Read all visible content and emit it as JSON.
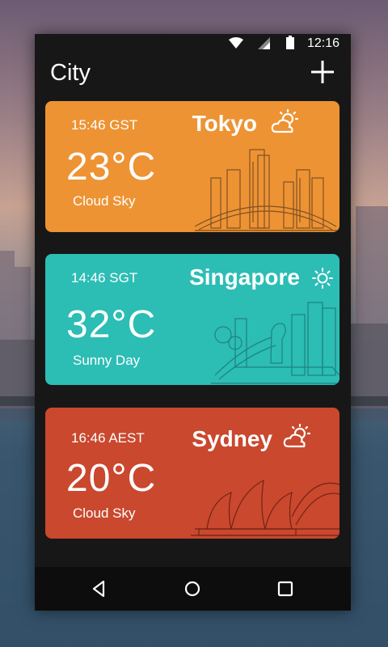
{
  "status_bar": {
    "time": "12:16",
    "icons": [
      "wifi-icon",
      "signal-icon",
      "battery-icon"
    ]
  },
  "app_bar": {
    "title": "City",
    "add_icon": "plus-icon"
  },
  "cities": [
    {
      "time": "15:46 GST",
      "temperature": "23°C",
      "condition": "Cloud Sky",
      "name": "Tokyo",
      "weather_icon": "partly-cloudy-icon",
      "color": "#ED9334"
    },
    {
      "time": "14:46 SGT",
      "temperature": "32°C",
      "condition": "Sunny Day",
      "name": "Singapore",
      "weather_icon": "sun-icon",
      "color": "#2CBDB5"
    },
    {
      "time": "16:46 AEST",
      "temperature": "20°C",
      "condition": "Cloud Sky",
      "name": "Sydney",
      "weather_icon": "partly-cloudy-icon",
      "color": "#C9482E"
    }
  ],
  "nav_bar": {
    "icons": [
      "back-icon",
      "home-icon",
      "recents-icon"
    ]
  }
}
